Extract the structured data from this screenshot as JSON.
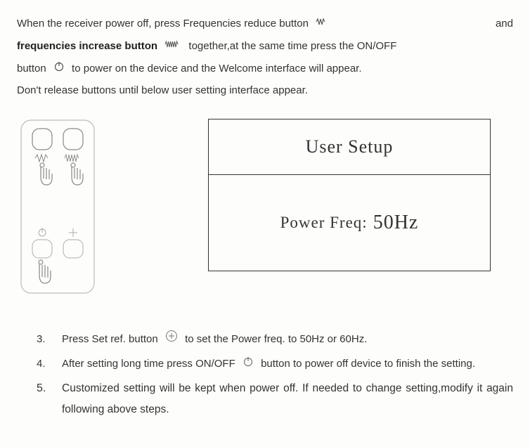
{
  "intro": {
    "line1a": "When  the  receiver  power  off,  press  Frequencies  reduce  button ",
    "line1b": " and",
    "line2a": "frequencies increase button ",
    "line2b": " together,at the same time press the ON/OFF",
    "line3a": "button ",
    "line3b": " to power on the device and the Welcome interface will appear.",
    "line4": "Don't release buttons until below user setting interface appear."
  },
  "screen": {
    "title": "User Setup",
    "label": "Power Freq:",
    "value": "50Hz"
  },
  "steps": {
    "s3num": "3.",
    "s3a": "Press Set ref. button ",
    "s3b": " to set the Power freq. to 50Hz or 60Hz.",
    "s4num": "4.",
    "s4a": "After setting long time press ON/OFF ",
    "s4b": " button to power off device to finish the setting.",
    "s5num": "5.",
    "s5": "Customized setting will be kept when power off. If needed to change setting,modify it again following above steps."
  }
}
